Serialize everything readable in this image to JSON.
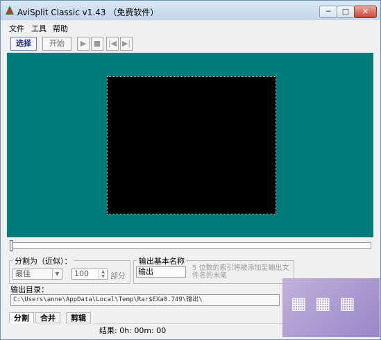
{
  "window": {
    "title": "AviSplit Classic v1.43 （免费软件）",
    "controls": {
      "min": "─",
      "max": "□",
      "close": "✕"
    }
  },
  "menu": {
    "items": [
      "文件",
      "工具",
      "帮助"
    ]
  },
  "toolbar": {
    "select_label": "选择",
    "start_label": "开始",
    "play_icon": "▶",
    "stop_icon": "■",
    "prev_icon": "|◀",
    "next_icon": "▶|"
  },
  "split_group": {
    "label": "分割为（近似）：",
    "mode_value": "最佳",
    "amount_value": "100",
    "unit_label": "部分"
  },
  "output_name_group": {
    "label": "输出基本名称",
    "value": "输出",
    "note": "5 位数的索引将被添加至输出文件名的末尾"
  },
  "output_dir": {
    "label": "输出目录：",
    "value": "C:\\Users\\anne\\AppData\\Local\\Temp\\Rar$EXa0.749\\输出\\"
  },
  "tabs": [
    "分割",
    "合并",
    "剪辑"
  ],
  "status": {
    "text": "结果: 0h: 00m: 00"
  },
  "colors": {
    "viewer_bg": "#007b7b",
    "video_bg": "#000000"
  }
}
